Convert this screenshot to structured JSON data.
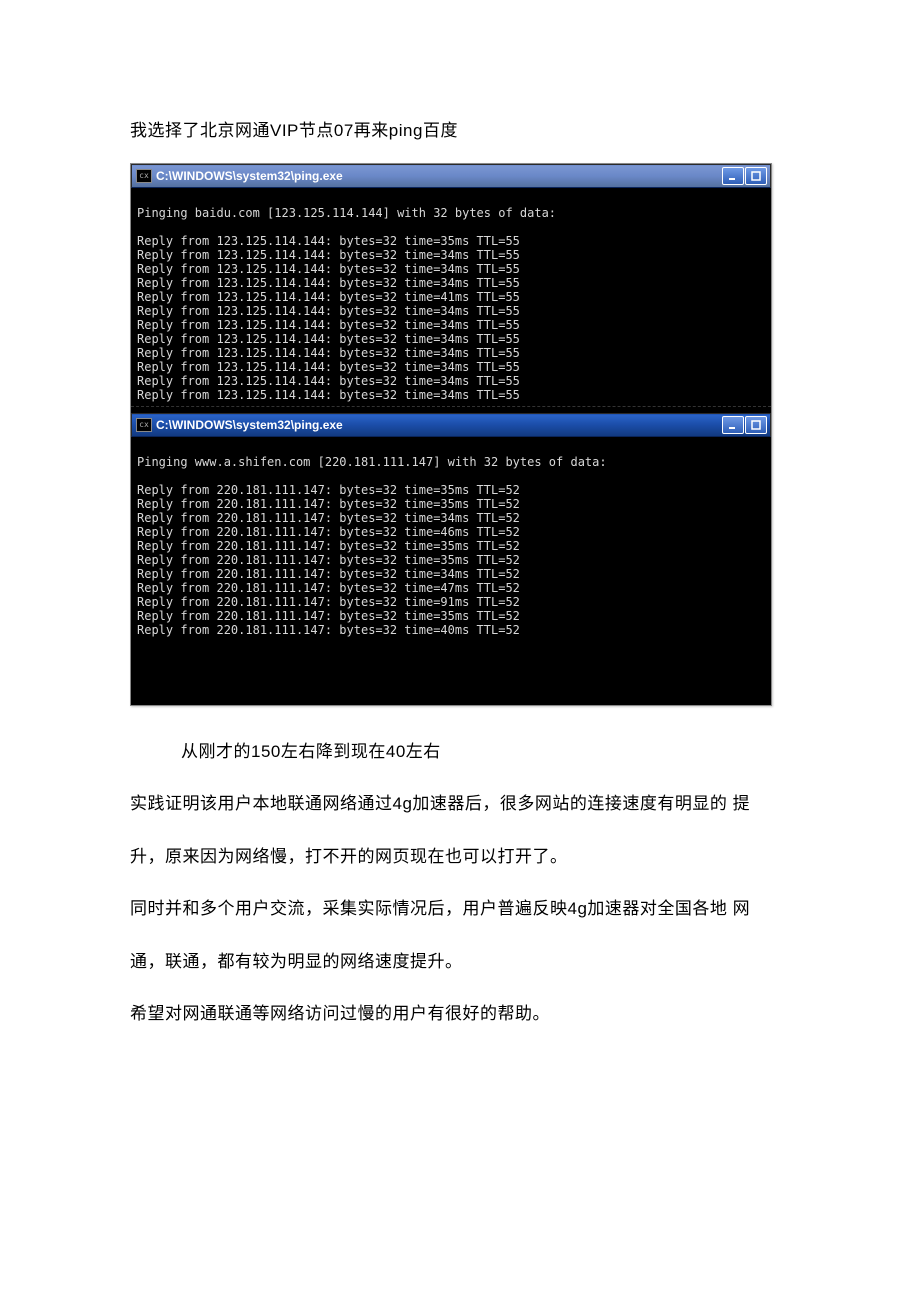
{
  "intro_text": "我选择了北京网通VIP节点07再来ping百度",
  "window1": {
    "title": "C:\\WINDOWS\\system32\\ping.exe",
    "icon_text": "cx",
    "header_line": "Pinging baidu.com [123.125.114.144] with 32 bytes of data:",
    "replies": [
      "Reply from 123.125.114.144: bytes=32 time=35ms TTL=55",
      "Reply from 123.125.114.144: bytes=32 time=34ms TTL=55",
      "Reply from 123.125.114.144: bytes=32 time=34ms TTL=55",
      "Reply from 123.125.114.144: bytes=32 time=34ms TTL=55",
      "Reply from 123.125.114.144: bytes=32 time=41ms TTL=55",
      "Reply from 123.125.114.144: bytes=32 time=34ms TTL=55",
      "Reply from 123.125.114.144: bytes=32 time=34ms TTL=55",
      "Reply from 123.125.114.144: bytes=32 time=34ms TTL=55",
      "Reply from 123.125.114.144: bytes=32 time=34ms TTL=55",
      "Reply from 123.125.114.144: bytes=32 time=34ms TTL=55",
      "Reply from 123.125.114.144: bytes=32 time=34ms TTL=55",
      "Reply from 123.125.114.144: bytes=32 time=34ms TTL=55"
    ]
  },
  "window2": {
    "title": "C:\\WINDOWS\\system32\\ping.exe",
    "icon_text": "cx",
    "header_line": "Pinging www.a.shifen.com [220.181.111.147] with 32 bytes of data:",
    "replies": [
      "Reply from 220.181.111.147: bytes=32 time=35ms TTL=52",
      "Reply from 220.181.111.147: bytes=32 time=35ms TTL=52",
      "Reply from 220.181.111.147: bytes=32 time=34ms TTL=52",
      "Reply from 220.181.111.147: bytes=32 time=46ms TTL=52",
      "Reply from 220.181.111.147: bytes=32 time=35ms TTL=52",
      "Reply from 220.181.111.147: bytes=32 time=35ms TTL=52",
      "Reply from 220.181.111.147: bytes=32 time=34ms TTL=52",
      "Reply from 220.181.111.147: bytes=32 time=47ms TTL=52",
      "Reply from 220.181.111.147: bytes=32 time=91ms TTL=52",
      "Reply from 220.181.111.147: bytes=32 time=35ms TTL=52",
      "Reply from 220.181.111.147: bytes=32 time=40ms TTL=52"
    ]
  },
  "caption_text": "从刚才的150左右降到现在40左右",
  "para1": "实践证明该用户本地联通网络通过4g加速器后，很多网站的连接速度有明显的 提",
  "para2": "升，原来因为网络慢，打不开的网页现在也可以打开了。",
  "para3": "同时并和多个用户交流，采集实际情况后，用户普遍反映4g加速器对全国各地 网",
  "para4": "通，联通，都有较为明显的网络速度提升。",
  "para5": "希望对网通联通等网络访问过慢的用户有很好的帮助。"
}
